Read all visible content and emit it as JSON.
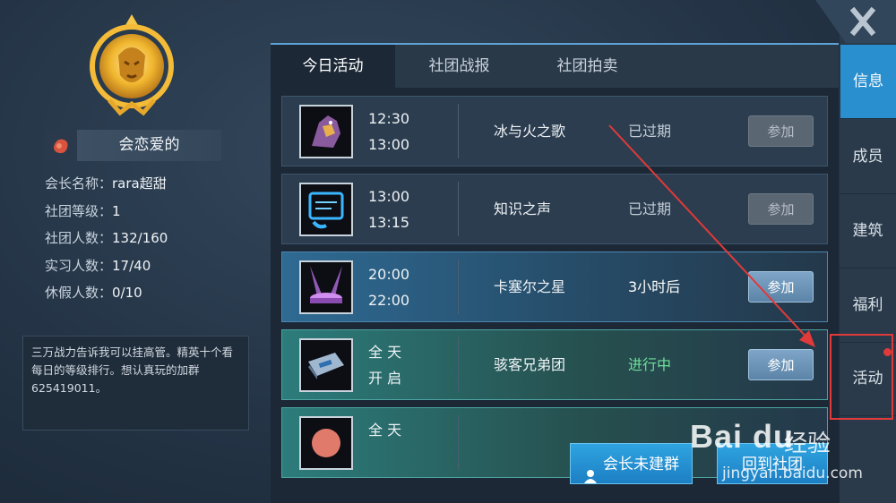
{
  "guild": {
    "name": "会恋爱的",
    "info": [
      {
        "label": "会长名称：",
        "value": "rara超甜"
      },
      {
        "label": "社团等级：",
        "value": "1"
      },
      {
        "label": "社团人数：",
        "value": "132/160"
      },
      {
        "label": "实习人数：",
        "value": "17/40"
      },
      {
        "label": "休假人数：",
        "value": "0/10"
      }
    ],
    "notice": "三万战力告诉我可以挂高管。精英十个看每日的等级排行。想认真玩的加群625419011。"
  },
  "tabs": [
    "今日活动",
    "社团战报",
    "社团拍卖"
  ],
  "activities": [
    {
      "start": "12:30",
      "end": "13:00",
      "name": "冰与火之歌",
      "status": "已过期",
      "join": "参加"
    },
    {
      "start": "13:00",
      "end": "13:15",
      "name": "知识之声",
      "status": "已过期",
      "join": "参加"
    },
    {
      "start": "20:00",
      "end": "22:00",
      "name": "卡塞尔之星",
      "status": "3小时后",
      "join": "参加"
    },
    {
      "start": "全 天",
      "end": "开 启",
      "name": "骇客兄弟团",
      "status": "进行中",
      "join": "参加"
    },
    {
      "start": "全 天",
      "end": "",
      "name": "",
      "status": "",
      "join": ""
    }
  ],
  "buttons": {
    "group": "会长未建群",
    "return": "回到社团"
  },
  "nav": [
    "信息",
    "成员",
    "建筑",
    "福利",
    "活动"
  ],
  "watermark": {
    "logo": "Bai du",
    "sub": "经验",
    "url": "jingyan.baidu.com"
  },
  "colors": {
    "accent": "#2a8fcf",
    "highlight": "#e03a3a",
    "live": "#6ee09a"
  }
}
